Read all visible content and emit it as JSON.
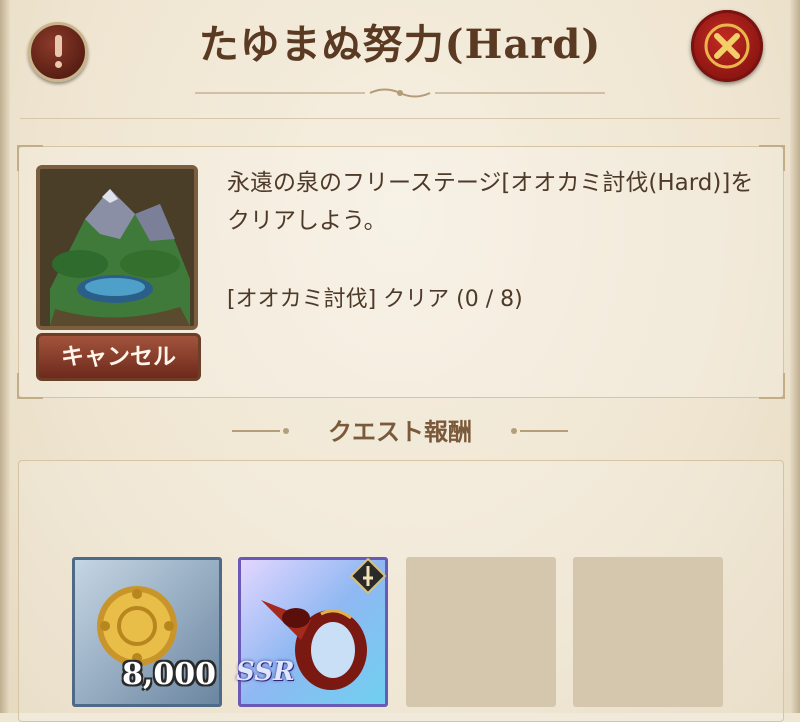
{
  "header": {
    "title": "たゆまぬ努力(Hard)",
    "alert_icon": "exclamation-icon",
    "close_icon": "close-x-icon"
  },
  "quest": {
    "description": "永遠の泉のフリーステージ[オオカミ討伐(Hard)]をクリアしよう。",
    "progress_text": "[オオカミ討伐] クリア (0 / 8)",
    "cancel_label": "キャンセル",
    "thumbnail_icon": "mountain-lake-landscape-icon"
  },
  "rewards": {
    "title": "クエスト報酬",
    "items": [
      {
        "icon": "gold-coin-icon",
        "quantity": "8,000"
      },
      {
        "icon": "ring-accessory-icon",
        "rarity": "SSR",
        "badge_icon": "sword-icon"
      },
      {
        "icon": "empty-slot"
      },
      {
        "icon": "empty-slot"
      }
    ]
  },
  "colors": {
    "panel_bg": "#efe6d3",
    "title_text": "#5a3a22",
    "close_red": "#c22a22",
    "cancel_btn": "#8a3a2a"
  }
}
